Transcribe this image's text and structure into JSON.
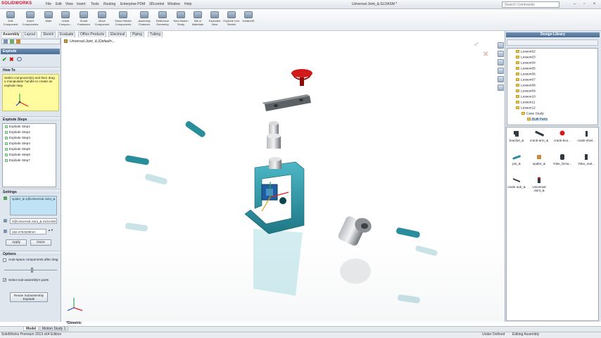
{
  "app": {
    "logo": "SOLIDWORKS",
    "doc_title": "Universal Joint_&.SLDASM *"
  },
  "menu": [
    "File",
    "Edit",
    "View",
    "Insert",
    "Tools",
    "Routing",
    "Enterprise PDM",
    "3Dcontrol",
    "Window",
    "Help"
  ],
  "search": {
    "placeholder": "Search Commands"
  },
  "ribbon": {
    "buttons": [
      "Edit Component",
      "Insert Components",
      "Mate",
      "Linear Compon...",
      "Smart Fasteners",
      "Move Component",
      "Show Hidden Components",
      "Assembly Features",
      "Reference Geometry",
      "New Motion Study",
      "Bill of Materials",
      "Exploded View",
      "Explode Line Sketch",
      "Instant3D"
    ]
  },
  "tabs": [
    "Assembly",
    "Layout",
    "Sketch",
    "Evaluate",
    "Office Products",
    "Electrical",
    "Piping",
    "Tubing"
  ],
  "left": {
    "pm_title": "Explode",
    "howto_title": "How To",
    "howto_text": "Select component(s) and then drag a manipulator handle to create an explode step.",
    "steps_title": "Explode Steps",
    "steps": [
      "Explode Step1",
      "Explode Step2",
      "Explode Step3",
      "Explode Step4",
      "Explode Step5",
      "Explode Step6",
      "Explode Step7"
    ],
    "settings_title": "Settings",
    "settings_component": "spider_&-1@Universal Joint_&",
    "settings_direction": "Z@Universal Joint_&.SLDASM",
    "settings_distance": "182.4753339mm",
    "apply": "Apply",
    "done": "Done",
    "options_title": "Options",
    "opt_auto_space": "Auto-space components after drag",
    "opt_sub_assembly": "Select sub-assembly's parts",
    "reuse_button": "Reuse Subassembly Explode"
  },
  "viewport": {
    "tree_root": "Universal Joint_&  (Default<...",
    "view_label": "*Dimetric"
  },
  "design_library": {
    "title": "Design Library",
    "tree": [
      "Lesson02",
      "Lesson03",
      "Lesson04",
      "Lesson05",
      "Lesson06",
      "Lesson07",
      "Lesson08",
      "Lesson09",
      "Lesson10",
      "Lesson11",
      "Lesson12",
      "Case Study",
      "Built Parts"
    ],
    "parts": [
      "bracket_&",
      "crank-arm_&",
      "crank-kno...",
      "crank-shaf...",
      "pin_&",
      "spider_&",
      "Yoke_fema...",
      "Yoke_mal...",
      "crank sub_&",
      "Universal Joint_&"
    ]
  },
  "bottom_tabs": [
    "Model",
    "Motion Study 1"
  ],
  "status": {
    "left": "SolidWorks Premium 2013 x64 Edition",
    "state": "Under Defined",
    "mode": "Editing Assembly"
  },
  "colors": {
    "part_teal": "#2a8d9c",
    "accent_red": "#d11a1a",
    "pm_header": "#4e6f96"
  }
}
